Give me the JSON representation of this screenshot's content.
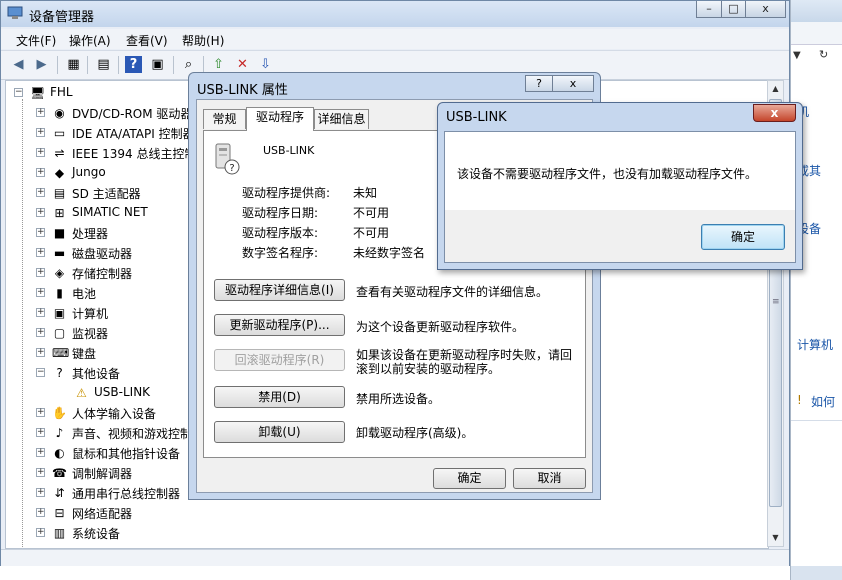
{
  "background_window": {
    "texts": [
      "机",
      "或其",
      "设备",
      "计算机",
      "如何"
    ]
  },
  "device_manager": {
    "title": "设备管理器",
    "menu": [
      "文件(F)",
      "操作(A)",
      "查看(V)",
      "帮助(H)"
    ],
    "toolbar_icons": [
      "back-arrow-icon",
      "forward-arrow-icon",
      "show-hide-tree-icon",
      "properties-icon",
      "help-icon",
      "view-icon",
      "scan-hardware-icon",
      "update-driver-icon",
      "disable-device-icon",
      "uninstall-device-icon"
    ],
    "tree": {
      "root": "FHL",
      "items": [
        {
          "label": "DVD/CD-ROM 驱动器",
          "icon": "dvd-drive-icon"
        },
        {
          "label": "IDE ATA/ATAPI 控制器",
          "icon": "ide-controller-icon"
        },
        {
          "label": "IEEE 1394 总线主控制器",
          "icon": "ieee1394-icon"
        },
        {
          "label": "Jungo",
          "icon": "jungo-icon"
        },
        {
          "label": "SD 主适配器",
          "icon": "sd-host-icon"
        },
        {
          "label": "SIMATIC NET",
          "icon": "network-icon"
        },
        {
          "label": "处理器",
          "icon": "processor-icon"
        },
        {
          "label": "磁盘驱动器",
          "icon": "disk-drive-icon"
        },
        {
          "label": "存储控制器",
          "icon": "storage-controller-icon"
        },
        {
          "label": "电池",
          "icon": "battery-icon"
        },
        {
          "label": "计算机",
          "icon": "computer-icon"
        },
        {
          "label": "监视器",
          "icon": "monitor-icon"
        },
        {
          "label": "键盘",
          "icon": "keyboard-icon"
        },
        {
          "label": "其他设备",
          "icon": "other-devices-icon",
          "expanded": true
        },
        {
          "label": "USB-LINK",
          "icon": "warning-device-icon",
          "child": true
        },
        {
          "label": "人体学输入设备",
          "icon": "hid-icon"
        },
        {
          "label": "声音、视频和游戏控制器",
          "icon": "sound-icon"
        },
        {
          "label": "鼠标和其他指针设备",
          "icon": "mouse-icon"
        },
        {
          "label": "调制解调器",
          "icon": "modem-icon"
        },
        {
          "label": "通用串行总线控制器",
          "icon": "usb-controller-icon"
        },
        {
          "label": "网络适配器",
          "icon": "network-adapter-icon"
        },
        {
          "label": "系统设备",
          "icon": "system-device-icon"
        }
      ]
    }
  },
  "properties_dialog": {
    "title": "USB-LINK 属性",
    "help": "?",
    "tabs": [
      "常规",
      "驱动程序",
      "详细信息"
    ],
    "device_name": "USB-LINK",
    "fields": [
      {
        "label": "驱动程序提供商:",
        "value": "未知"
      },
      {
        "label": "驱动程序日期:",
        "value": "不可用"
      },
      {
        "label": "驱动程序版本:",
        "value": "不可用"
      },
      {
        "label": "数字签名程序:",
        "value": "未经数字签名"
      }
    ],
    "actions": [
      {
        "button": "驱动程序详细信息(I)",
        "desc": "查看有关驱动程序文件的详细信息。",
        "disabled": false
      },
      {
        "button": "更新驱动程序(P)...",
        "desc": "为这个设备更新驱动程序软件。",
        "disabled": false
      },
      {
        "button": "回滚驱动程序(R)",
        "desc": "如果该设备在更新驱动程序时失败，请回滚到以前安装的驱动程序。",
        "desc_line1": "如果该设备在更新驱动程序时失败，请回",
        "desc_line2": "滚到以前安装的驱动程序。",
        "disabled": true
      },
      {
        "button": "禁用(D)",
        "desc": "禁用所选设备。",
        "disabled": false
      },
      {
        "button": "卸载(U)",
        "desc": "卸载驱动程序(高级)。",
        "disabled": false
      }
    ],
    "ok": "确定",
    "cancel": "取消"
  },
  "message_box": {
    "title": "USB-LINK",
    "close": "x",
    "text": "该设备不需要驱动程序文件，也没有加载驱动程序文件。",
    "ok": "确定"
  },
  "colors": {
    "title_gradient_top": "#dbe7f6",
    "dialog_frame": "#c6d7ee",
    "close_red": "#c4452b",
    "link_blue": "#1a56a8"
  }
}
